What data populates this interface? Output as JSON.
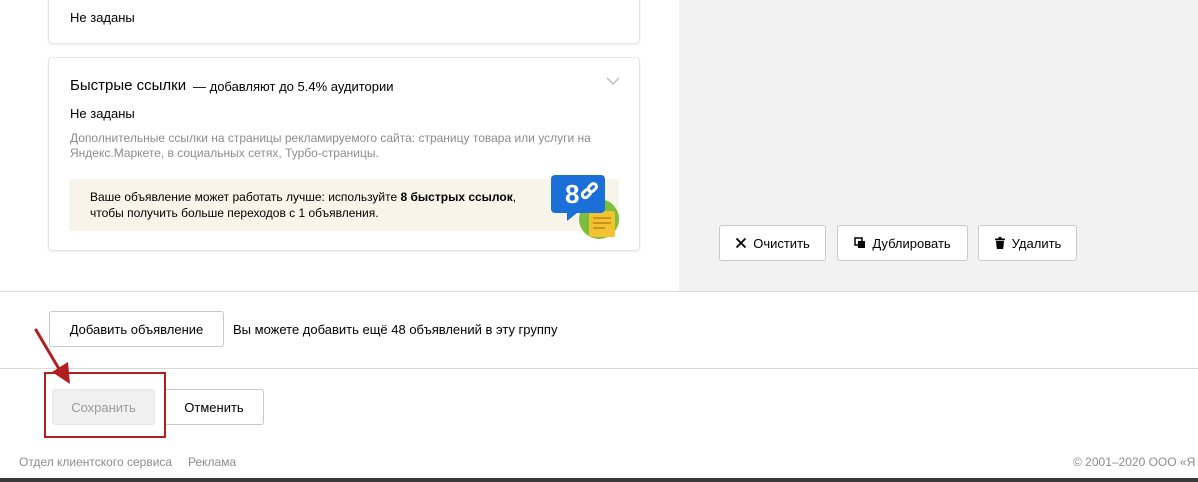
{
  "top_card": {
    "value": "Не заданы"
  },
  "quick_links": {
    "title": "Быстрые ссылки",
    "title_note": "— добавляют до 5.4% аудитории",
    "value": "Не заданы",
    "hint": "Дополнительные ссылки на страницы рекламируемого сайта: страницу товара или услуги на Яндекс.Маркете, в социальных сетях, Турбо-страницы.",
    "tip": {
      "text_before": "Ваше объявление может работать лучше: используйте ",
      "text_bold": "8 быстрых ссылок",
      "text_after": ", чтобы получить больше переходов с 1 объявления.",
      "badge_number": "8"
    }
  },
  "actions": {
    "clear_label": "Очистить",
    "duplicate_label": "Дублировать",
    "delete_label": "Удалить"
  },
  "add_ad": {
    "button_label": "Добавить объявление",
    "note": "Вы можете добавить ещё 48 объявлений в эту группу"
  },
  "form_buttons": {
    "save_label": "Сохранить",
    "cancel_label": "Отменить"
  },
  "footer": {
    "links": [
      "Отдел клиентского сервиса",
      "Реклама"
    ],
    "copyright": "© 2001–2020 ООО «Я"
  },
  "colors": {
    "highlight": "#b31f1f",
    "badge_blue": "#1a6fd9",
    "tip_bg": "#f8f4ea"
  }
}
